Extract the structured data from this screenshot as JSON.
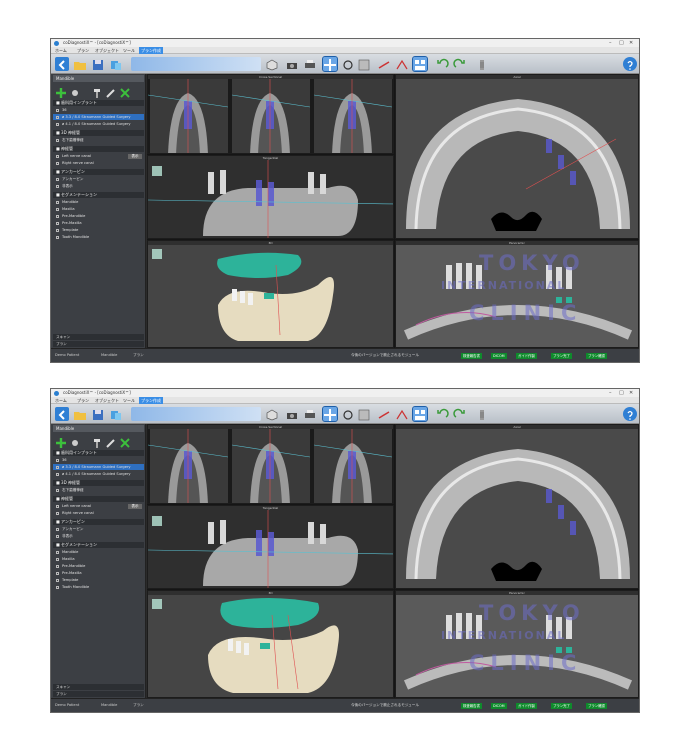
{
  "app": {
    "title": "coDiagnostiX™ - [coDiagnostiX™]",
    "window_controls": [
      "–",
      "□",
      "✕"
    ]
  },
  "menu": [
    "ホーム",
    "プラン",
    "オブジェクト",
    "ツール",
    "プラン作成"
  ],
  "menu_active_index": 4,
  "sidebar": {
    "panel_tab": "Mandible",
    "sections": [
      {
        "title": "■ 歯科用インプラント",
        "rows": [
          "36",
          "ø 3.3 / 8.0 Straumann Guided Surgery",
          "ø 4.1 / 8.0 Straumann Guided Surgery"
        ]
      },
      {
        "title": "■ 3D 神経管",
        "rows": [
          "右下歯槽神経"
        ]
      },
      {
        "title": "■ 神経管",
        "rows": [
          "Left nerve canal",
          "Right nerve canal"
        ],
        "row_button": "表示"
      },
      {
        "title": "■ アンカーピン",
        "rows": [
          "アンカーピン",
          "非表示"
        ]
      },
      {
        "title": "■ セグメンテーション",
        "rows": [
          "Mandible",
          "Maxilla",
          "Pre-Mandible",
          "Pre-Maxilla",
          "Template",
          "Tooth Mandible"
        ]
      }
    ],
    "bottom_rows": [
      "スキャン",
      "プラン"
    ]
  },
  "views": {
    "cross_section_title": "Cross-Sectional",
    "axial_title": "Axial",
    "tangential_title": "Tangential",
    "three_d_title": "3D",
    "panoramic_title": "Panoramic"
  },
  "statusbar": {
    "items": [
      "Demo Patient",
      "Mandible",
      "プラン"
    ],
    "hint": "今後のバージョンで廃止されるモジュール",
    "green_items": [
      "検査報告書",
      "DICOM",
      "ガイド作製",
      "プラン完了",
      "プラン確認"
    ]
  },
  "watermark": {
    "lines": [
      "TOKYO",
      "INTERNATIONAL",
      "CLINIC"
    ]
  },
  "colors": {
    "accent": "#2f7fd4",
    "panel_bg": "#3c3f44",
    "status_green": "#0f8a2c",
    "implant_blue": "#5a5ad0",
    "template_teal": "#2db39a"
  }
}
